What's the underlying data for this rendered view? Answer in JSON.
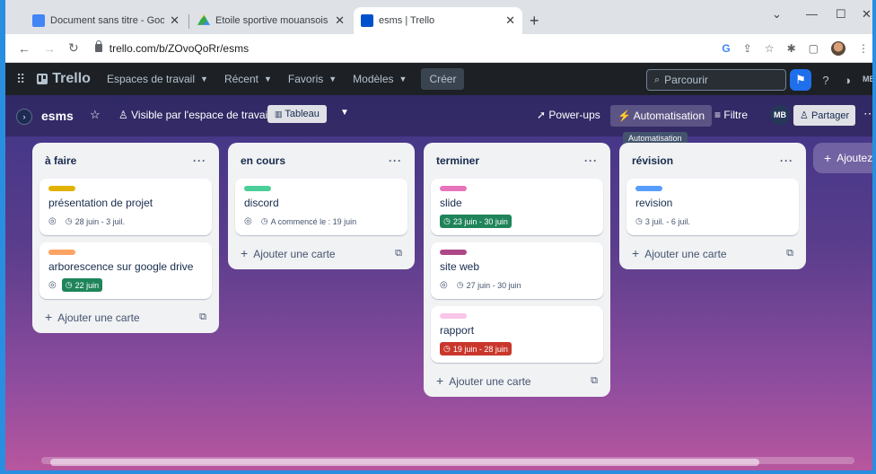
{
  "browser": {
    "tabs": [
      {
        "title": "Document sans titre - Google Do",
        "icon": "google-docs-icon",
        "color": "#4285f4"
      },
      {
        "title": "Etoile sportive mouansois - Goog",
        "icon": "google-drive-icon",
        "color": "#fbbc04"
      },
      {
        "title": "esms | Trello",
        "icon": "trello-icon",
        "color": "#0052cc"
      }
    ],
    "url": "trello.com/b/ZOvoQoRr/esms"
  },
  "header": {
    "logo": "Trello",
    "menus": [
      "Espaces de travail",
      "Récent",
      "Favoris",
      "Modèles"
    ],
    "create_label": "Créer",
    "search_placeholder": "Parcourir",
    "avatar_initials": "MB"
  },
  "board": {
    "name": "esms",
    "visibility": "Visible par l'espace de travail",
    "view": "Tableau",
    "powerups": "Power-ups",
    "automation": "Automatisation",
    "filter": "Filtre",
    "member": "MB",
    "share": "Partager",
    "tooltip": "Automatisation",
    "add_list": "Ajoutez u"
  },
  "lists": [
    {
      "title": "à faire",
      "add_card": "Ajouter une carte",
      "cards": [
        {
          "title": "présentation de projet",
          "label_color": "#e2b203",
          "due": "28 juin - 3 juil.",
          "due_style": "plain",
          "watch": true
        },
        {
          "title": "arborescence sur google drive",
          "label_color": "#fea362",
          "due": "22 juin",
          "due_style": "green",
          "watch": true
        }
      ]
    },
    {
      "title": "en cours",
      "add_card": "Ajouter une carte",
      "cards": [
        {
          "title": "discord",
          "label_color": "#4bce97",
          "due": "A commencé le : 19 juin",
          "due_style": "plain",
          "watch": true
        }
      ]
    },
    {
      "title": "terminer",
      "add_card": "Ajouter une carte",
      "cards": [
        {
          "title": "slide",
          "label_color": "#e774bb",
          "due": "23 juin - 30 juin",
          "due_style": "green",
          "watch": false
        },
        {
          "title": "site web",
          "label_color": "#ae4787",
          "due": "27 juin - 30 juin",
          "due_style": "plain",
          "watch": true
        },
        {
          "title": "rapport",
          "label_color": "#f9c5e8",
          "due": "19 juin - 28 juin",
          "due_style": "red",
          "watch": false
        }
      ]
    },
    {
      "title": "révision",
      "add_card": "Ajouter une carte",
      "cards": [
        {
          "title": "revision",
          "label_color": "#579dff",
          "due": "3 juil. - 6 juil.",
          "due_style": "plain",
          "watch": false
        }
      ]
    }
  ]
}
